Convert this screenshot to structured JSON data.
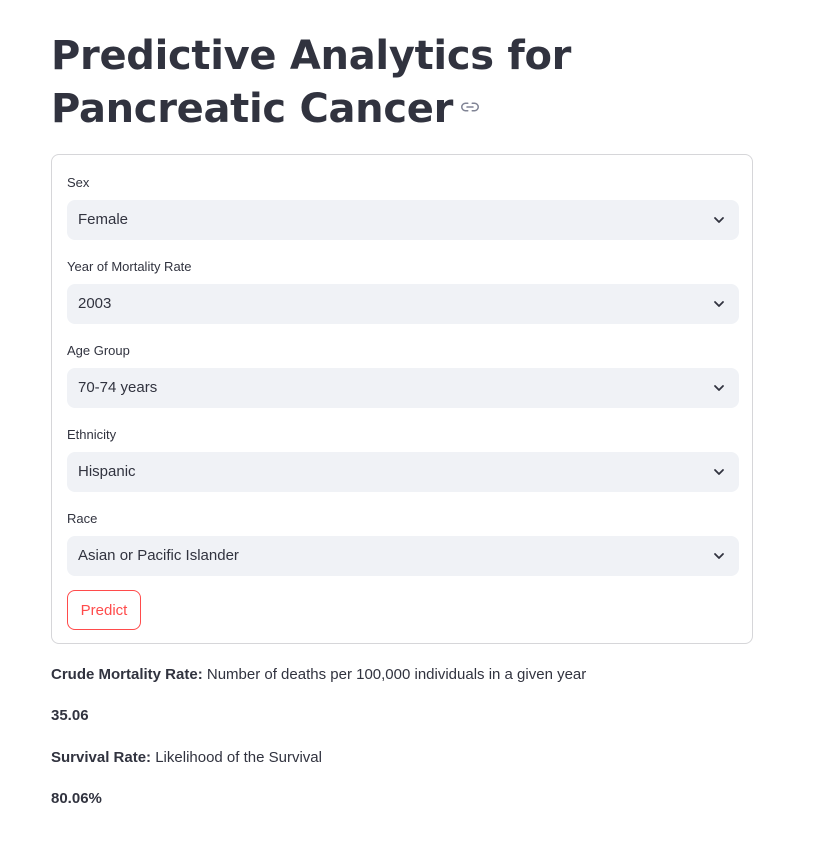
{
  "page": {
    "title": "Predictive Analytics for Pancreatic Cancer",
    "link_icon": "link-icon"
  },
  "form": {
    "fields": [
      {
        "label": "Sex",
        "value": "Female"
      },
      {
        "label": "Year of Mortality Rate",
        "value": "2003"
      },
      {
        "label": "Age Group",
        "value": "70-74 years"
      },
      {
        "label": "Ethnicity",
        "value": "Hispanic"
      },
      {
        "label": "Race",
        "value": "Asian or Pacific Islander"
      }
    ],
    "predict_label": "Predict"
  },
  "results": {
    "crude_label": "Crude Mortality Rate:",
    "crude_desc": " Number of deaths per 100,000 individuals in a given year",
    "crude_value": "35.06",
    "survival_label": "Survival Rate:",
    "survival_desc": " Likelihood of the Survival",
    "survival_value": "80.06%"
  },
  "colors": {
    "accent": "#ff4b4b",
    "text": "#31333f",
    "select_bg": "#f0f2f6",
    "border": "#d6d6d9"
  }
}
